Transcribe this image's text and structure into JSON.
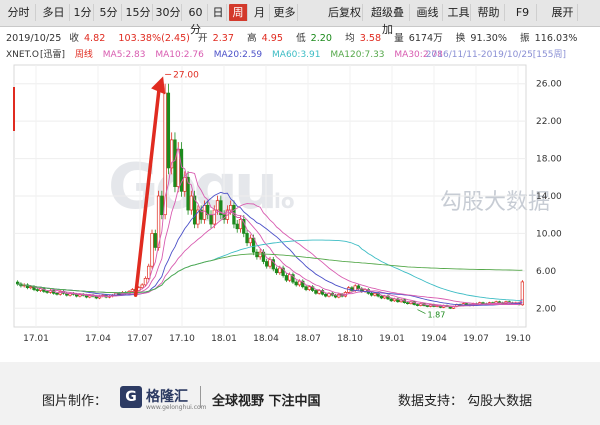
{
  "toolbar": {
    "buttons": [
      "分时",
      "多日",
      "1分",
      "5分",
      "15分",
      "30分",
      "60分",
      "日",
      "周",
      "月",
      "更多",
      "后复权",
      "超级叠加",
      "画线",
      "工具",
      "帮助",
      "F9",
      "展开"
    ],
    "active": "周"
  },
  "info": {
    "date": "2019/10/25",
    "close_label": "收",
    "close": "4.82",
    "change": "103.38%(2.45)",
    "open_label": "开",
    "open": "2.37",
    "high_label": "高",
    "high": "4.95",
    "low_label": "低",
    "low": "2.20",
    "avg_label": "均",
    "avg": "3.58",
    "volume_label": "量",
    "volume": "6174万",
    "turnover_label": "换",
    "turnover": "91.30%",
    "amplitude_label": "振",
    "amplitude": "116.03%"
  },
  "indicators": {
    "ticker": "XNET.O",
    "badge": "[迅雷]",
    "period": "周线",
    "ma5": "MA5:2.83",
    "ma10": "MA10:2.76",
    "ma20": "MA20:2.59",
    "ma60": "MA60:3.91",
    "ma120": "MA120:7.33",
    "ma30": "MA30:2.78",
    "range": "2016/11/11-2019/10/25[155周]"
  },
  "watermark": {
    "text": "勾股大数据",
    "brand": "Gogu",
    "suffix": "io"
  },
  "footer": {
    "made_by": "图片制作：",
    "logo_mark": "G",
    "logo_name": "格隆汇",
    "logo_url": "www.gelonghui.com",
    "slogan": "全球视野 下注中国",
    "data_support": "数据支持：  勾股大数据"
  },
  "colors": {
    "up": "#e02b20",
    "down": "#1c8a1c",
    "ma5": "#d85bb0",
    "ma10": "#d85bb0",
    "ma20": "#4b50c8",
    "ma60": "#3cbcc4",
    "ma120": "#55a84a",
    "ma30": "#d85bb0",
    "arrow": "#e02b20"
  },
  "chart_data": {
    "type": "candlestick",
    "y_ticks": [
      "26.00",
      "22.00",
      "18.00",
      "14.00",
      "10.00",
      "6.00",
      "2.00"
    ],
    "ylim": [
      0,
      28
    ],
    "x_ticks": [
      "17.01",
      "17.04",
      "17.07",
      "17.10",
      "18.01",
      "18.04",
      "18.07",
      "18.10",
      "19.01",
      "19.04",
      "19.07",
      "19.10"
    ],
    "annotations": {
      "peak_label": "27.00",
      "low_label": "1.87"
    },
    "weeks": [
      [
        4.8,
        4.6
      ],
      [
        4.6,
        4.4
      ],
      [
        4.4,
        4.5
      ],
      [
        4.5,
        4.2
      ],
      [
        4.2,
        4.3
      ],
      [
        4.3,
        4.0
      ],
      [
        4.0,
        3.9
      ],
      [
        3.9,
        4.1
      ],
      [
        4.1,
        3.8
      ],
      [
        3.8,
        3.7
      ],
      [
        3.7,
        3.9
      ],
      [
        3.9,
        3.6
      ],
      [
        3.6,
        3.5
      ],
      [
        3.5,
        3.8
      ],
      [
        3.8,
        3.6
      ],
      [
        3.6,
        3.4
      ],
      [
        3.4,
        3.6
      ],
      [
        3.6,
        3.5
      ],
      [
        3.5,
        3.3
      ],
      [
        3.3,
        3.5
      ],
      [
        3.5,
        3.4
      ],
      [
        3.4,
        3.2
      ],
      [
        3.2,
        3.4
      ],
      [
        3.4,
        3.3
      ],
      [
        3.3,
        3.1
      ],
      [
        3.1,
        3.3
      ],
      [
        3.3,
        3.4
      ],
      [
        3.4,
        3.2
      ],
      [
        3.2,
        3.3
      ],
      [
        3.3,
        3.4
      ],
      [
        3.4,
        3.6
      ],
      [
        3.6,
        3.5
      ],
      [
        3.5,
        3.7
      ],
      [
        3.7,
        3.6
      ],
      [
        3.6,
        3.8
      ],
      [
        3.8,
        4.0
      ],
      [
        4.0,
        3.9
      ],
      [
        3.9,
        4.2
      ],
      [
        4.2,
        4.5
      ],
      [
        4.5,
        5.2
      ],
      [
        5.2,
        6.5
      ],
      [
        6.5,
        10.0
      ],
      [
        10.0,
        8.5
      ],
      [
        8.5,
        14.0
      ],
      [
        14.0,
        12.0
      ],
      [
        12.0,
        25.0
      ],
      [
        25.0,
        17.0
      ],
      [
        17.0,
        20.0
      ],
      [
        20.0,
        15.0
      ],
      [
        15.0,
        19.0
      ],
      [
        19.0,
        14.5
      ],
      [
        14.5,
        16.0
      ],
      [
        16.0,
        12.5
      ],
      [
        12.5,
        14.0
      ],
      [
        14.0,
        11.0
      ],
      [
        11.0,
        12.5
      ],
      [
        12.5,
        11.5
      ],
      [
        11.5,
        13.0
      ],
      [
        13.0,
        12.0
      ],
      [
        12.0,
        11.0
      ],
      [
        11.0,
        12.5
      ],
      [
        12.5,
        13.5
      ],
      [
        13.5,
        12.0
      ],
      [
        12.0,
        11.5
      ],
      [
        11.5,
        12.5
      ],
      [
        12.5,
        13.0
      ],
      [
        13.0,
        11.0
      ],
      [
        11.0,
        10.5
      ],
      [
        10.5,
        11.5
      ],
      [
        11.5,
        10.0
      ],
      [
        10.0,
        9.0
      ],
      [
        9.0,
        9.5
      ],
      [
        9.5,
        8.0
      ],
      [
        8.0,
        7.5
      ],
      [
        7.5,
        8.0
      ],
      [
        8.0,
        7.0
      ],
      [
        7.0,
        6.5
      ],
      [
        6.5,
        7.2
      ],
      [
        7.2,
        6.2
      ],
      [
        6.2,
        5.8
      ],
      [
        5.8,
        6.3
      ],
      [
        6.3,
        5.5
      ],
      [
        5.5,
        5.0
      ],
      [
        5.0,
        5.6
      ],
      [
        5.6,
        4.8
      ],
      [
        4.8,
        4.5
      ],
      [
        4.5,
        4.9
      ],
      [
        4.9,
        4.3
      ],
      [
        4.3,
        4.0
      ],
      [
        4.0,
        4.3
      ],
      [
        4.3,
        3.9
      ],
      [
        3.9,
        3.6
      ],
      [
        3.6,
        3.9
      ],
      [
        3.9,
        3.5
      ],
      [
        3.5,
        3.3
      ],
      [
        3.3,
        3.6
      ],
      [
        3.6,
        3.4
      ],
      [
        3.4,
        3.2
      ],
      [
        3.2,
        3.5
      ],
      [
        3.5,
        3.3
      ],
      [
        3.3,
        3.7
      ],
      [
        3.7,
        4.2
      ],
      [
        4.2,
        3.9
      ],
      [
        3.9,
        4.4
      ],
      [
        4.4,
        4.1
      ],
      [
        4.1,
        3.8
      ],
      [
        3.8,
        4.0
      ],
      [
        4.0,
        3.6
      ],
      [
        3.6,
        3.4
      ],
      [
        3.4,
        3.6
      ],
      [
        3.6,
        3.3
      ],
      [
        3.3,
        3.1
      ],
      [
        3.1,
        3.3
      ],
      [
        3.3,
        3.0
      ],
      [
        3.0,
        2.8
      ],
      [
        2.8,
        3.0
      ],
      [
        3.0,
        2.7
      ],
      [
        2.7,
        2.9
      ],
      [
        2.9,
        2.6
      ],
      [
        2.6,
        2.5
      ],
      [
        2.5,
        2.7
      ],
      [
        2.7,
        2.4
      ],
      [
        2.4,
        2.3
      ],
      [
        2.3,
        2.5
      ],
      [
        2.5,
        2.3
      ],
      [
        2.3,
        2.2
      ],
      [
        2.2,
        2.4
      ],
      [
        2.4,
        2.2
      ],
      [
        2.2,
        2.3
      ],
      [
        2.3,
        2.1
      ],
      [
        2.1,
        2.3
      ],
      [
        2.3,
        2.2
      ],
      [
        2.2,
        2.0
      ],
      [
        2.0,
        2.2
      ],
      [
        2.2,
        2.4
      ],
      [
        2.4,
        2.3
      ],
      [
        2.3,
        2.5
      ],
      [
        2.5,
        2.4
      ],
      [
        2.4,
        2.3
      ],
      [
        2.3,
        2.5
      ],
      [
        2.5,
        2.4
      ],
      [
        2.4,
        2.6
      ],
      [
        2.6,
        2.5
      ],
      [
        2.5,
        2.4
      ],
      [
        2.4,
        2.6
      ],
      [
        2.6,
        2.5
      ],
      [
        2.5,
        2.7
      ],
      [
        2.7,
        2.6
      ],
      [
        2.6,
        2.5
      ],
      [
        2.5,
        2.7
      ],
      [
        2.7,
        2.6
      ],
      [
        2.6,
        2.5
      ],
      [
        2.5,
        2.6
      ],
      [
        2.6,
        2.4
      ],
      [
        2.37,
        4.82
      ]
    ]
  }
}
